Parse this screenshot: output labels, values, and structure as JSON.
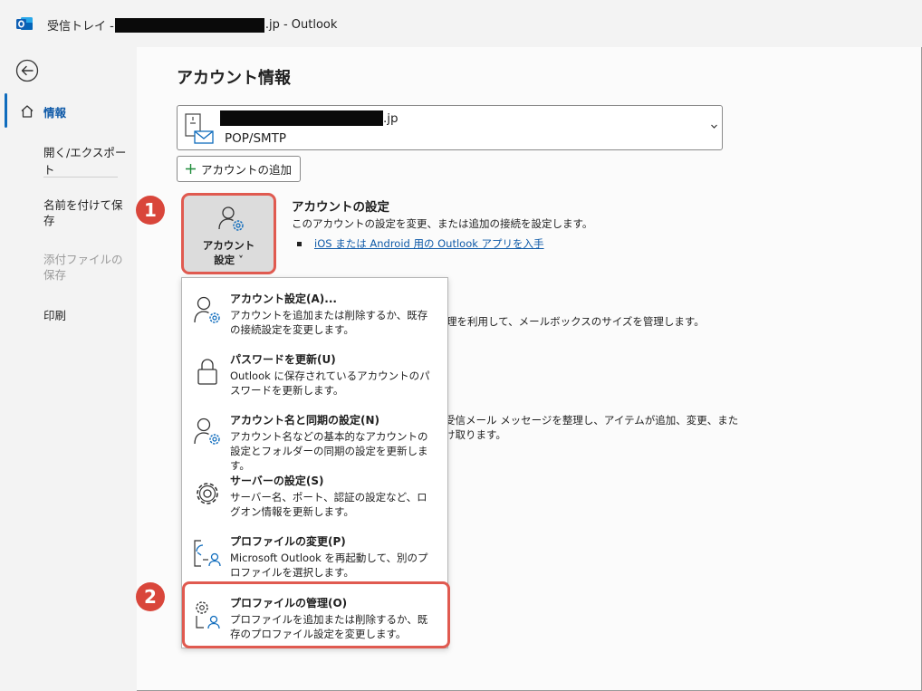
{
  "window": {
    "title_prefix": "受信トレイ - ",
    "title_suffix": ".jp  -  Outlook"
  },
  "sidebar": {
    "items": [
      {
        "label": "情報"
      },
      {
        "label": "開く/エクスポート"
      },
      {
        "label": "名前を付けて保存"
      },
      {
        "label": "添付ファイルの保存"
      },
      {
        "label": "印刷"
      }
    ]
  },
  "main": {
    "heading": "アカウント情報",
    "account": {
      "email_suffix": ".jp",
      "type": "POP/SMTP"
    },
    "add_account_label": "アカウントの追加",
    "account_settings_button": {
      "line1": "アカウント",
      "line2": "設定 ˅"
    },
    "section": {
      "title": "アカウントの設定",
      "description": "このアカウントの設定を変更、または追加の接続を設定します。",
      "link": "iOS または Android 用の Outlook アプリを入手"
    },
    "partial_text": [
      "理を利用して、メールボックスのサイズを管理します。",
      "受信メール メッセージを整理し、アイテムが追加、変更、また",
      "け取ります。"
    ]
  },
  "dropdown": {
    "items": [
      {
        "title": "アカウント設定(A)...",
        "desc": "アカウントを追加または削除するか、既存の接続設定を変更します。",
        "icon": "account-gear-icon"
      },
      {
        "title": "パスワードを更新(U)",
        "desc": "Outlook に保存されているアカウントのパスワードを更新します。",
        "icon": "lock-icon"
      },
      {
        "title": "アカウント名と同期の設定(N)",
        "desc": "アカウント名などの基本的なアカウントの設定とフォルダーの同期の設定を更新します。",
        "icon": "account-gear-icon"
      },
      {
        "title": "サーバーの設定(S)",
        "desc": "サーバー名、ポート、認証の設定など、ログオン情報を更新します。",
        "icon": "gear-icon"
      },
      {
        "title": "プロファイルの変更(P)",
        "desc": "Microsoft Outlook を再起動して、別のプロファイルを選択します。",
        "icon": "profile-switch-icon"
      },
      {
        "title": "プロファイルの管理(O)",
        "desc": "プロファイルを追加または削除するか、既存のプロファイル設定を変更します。",
        "icon": "profile-manage-icon"
      }
    ]
  },
  "annotations": {
    "step1": "1",
    "step2": "2",
    "color": "#d9463b"
  }
}
